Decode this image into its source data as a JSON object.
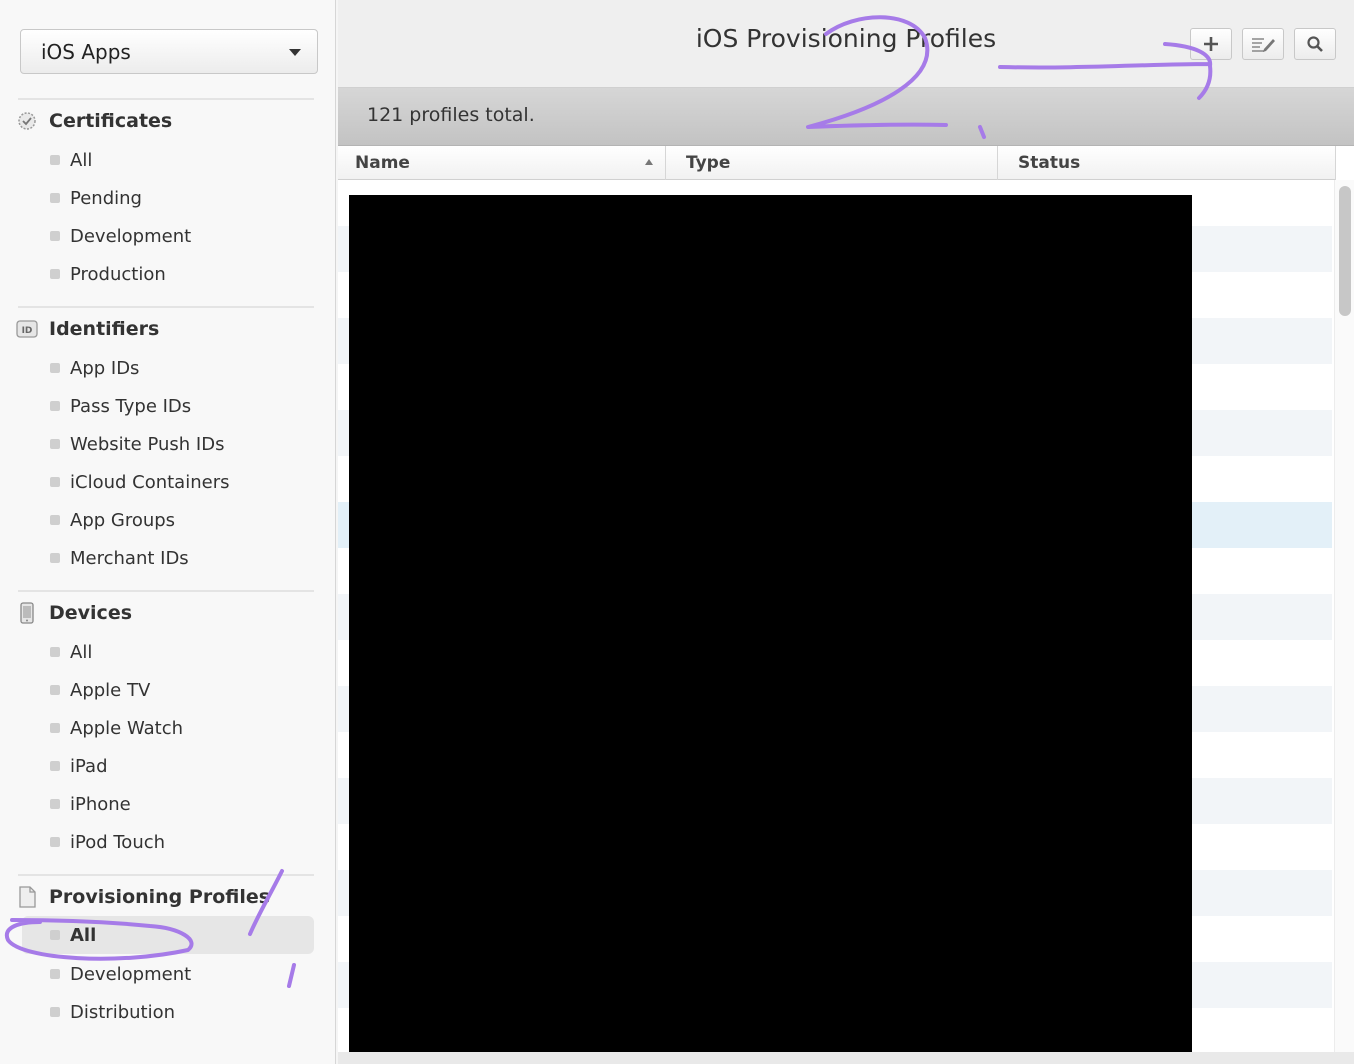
{
  "sidebar": {
    "app_selector": {
      "label": "iOS Apps"
    },
    "sections": [
      {
        "title": "Certificates",
        "icon": "certificate-icon",
        "items": [
          "All",
          "Pending",
          "Development",
          "Production"
        ]
      },
      {
        "title": "Identifiers",
        "icon": "id-badge-icon",
        "items": [
          "App IDs",
          "Pass Type IDs",
          "Website Push IDs",
          "iCloud Containers",
          "App Groups",
          "Merchant IDs"
        ]
      },
      {
        "title": "Devices",
        "icon": "device-icon",
        "items": [
          "All",
          "Apple TV",
          "Apple Watch",
          "iPad",
          "iPhone",
          "iPod Touch"
        ]
      },
      {
        "title": "Provisioning Profiles",
        "icon": "document-icon",
        "items": [
          "All",
          "Development",
          "Distribution"
        ],
        "active_index": 0
      }
    ]
  },
  "header": {
    "title": "iOS Provisioning Profiles",
    "buttons": {
      "add": "plus-icon",
      "edit": "edit-icon",
      "search": "search-icon"
    }
  },
  "summary": {
    "count_text": "121 profiles total."
  },
  "table": {
    "columns": [
      {
        "label": "Name",
        "sorted": "ascending"
      },
      {
        "label": "Type"
      },
      {
        "label": "Status"
      }
    ],
    "visible_rows": 19,
    "selected_row": 7,
    "redacted": true
  },
  "annotations": {
    "color": "#a67be8",
    "marks": [
      "2.",
      "1",
      "arrow-to-add-button",
      "circle-around-all"
    ]
  }
}
